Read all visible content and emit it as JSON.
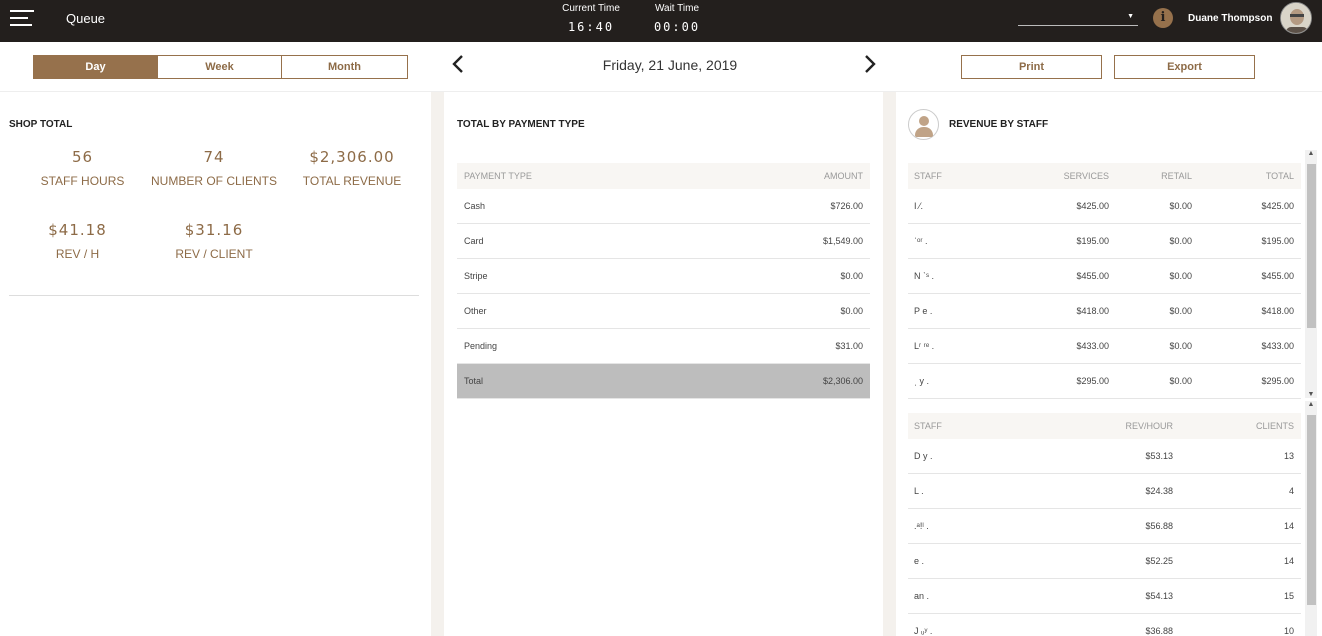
{
  "header": {
    "app_title": "Queue",
    "current_time_label": "Current Time",
    "current_time": "16:40",
    "wait_time_label": "Wait Time",
    "wait_time": "00:00",
    "shop_select_value": "",
    "user_name": "Duane Thompson"
  },
  "toolbar": {
    "periods": [
      "Day",
      "Week",
      "Month"
    ],
    "active_period": "Day",
    "date": "Friday, 21 June, 2019",
    "print_label": "Print",
    "export_label": "Export"
  },
  "shop_total": {
    "title": "SHOP TOTAL",
    "stats": [
      {
        "value": "56",
        "label": "STAFF HOURS"
      },
      {
        "value": "74",
        "label": "NUMBER OF CLIENTS"
      },
      {
        "value": "$2,306.00",
        "label": "TOTAL REVENUE"
      },
      {
        "value": "$41.18",
        "label": "REV / H"
      },
      {
        "value": "$31.16",
        "label": "REV / CLIENT"
      }
    ]
  },
  "payment": {
    "title": "TOTAL BY PAYMENT TYPE",
    "headers": [
      "PAYMENT TYPE",
      "AMOUNT"
    ],
    "rows": [
      [
        "Cash",
        "$726.00"
      ],
      [
        "Card",
        "$1,549.00"
      ],
      [
        "Stripe",
        "$0.00"
      ],
      [
        "Other",
        "$0.00"
      ],
      [
        "Pending",
        "$31.00"
      ]
    ],
    "total": [
      "Total",
      "$2,306.00"
    ]
  },
  "revenue_by_staff": {
    "title": "REVENUE BY STAFF",
    "headers": [
      "STAFF",
      "SERVICES",
      "RETAIL",
      "TOTAL"
    ],
    "rows": [
      [
        "I     ⁄.",
        "$425.00",
        "$0.00",
        "$425.00"
      ],
      [
        "ˈ​ᵒʳ   .",
        "$195.00",
        "$0.00",
        "$195.00"
      ],
      [
        "N ˋˢ .",
        "$455.00",
        "$0.00",
        "$455.00"
      ],
      [
        "P  e .",
        "$418.00",
        "$0.00",
        "$418.00"
      ],
      [
        "Lʳ  ʳᵉ .",
        "$433.00",
        "$0.00",
        "$433.00"
      ],
      [
        "ˌ y .",
        "$295.00",
        "$0.00",
        "$295.00"
      ]
    ],
    "headers2": [
      "STAFF",
      "REV/HOUR",
      "CLIENTS"
    ],
    "rows2": [
      [
        "D   y .",
        "$53.13",
        "13"
      ],
      [
        "L    .",
        "$24.38",
        "4"
      ],
      [
        ".ᵃ!ˡ .",
        "$56.88",
        "14"
      ],
      [
        " e   .",
        "$52.25",
        "14"
      ],
      [
        " an   .",
        "$54.13",
        "15"
      ],
      [
        "J ᵤʸ .",
        "$36.88",
        "10"
      ]
    ]
  }
}
